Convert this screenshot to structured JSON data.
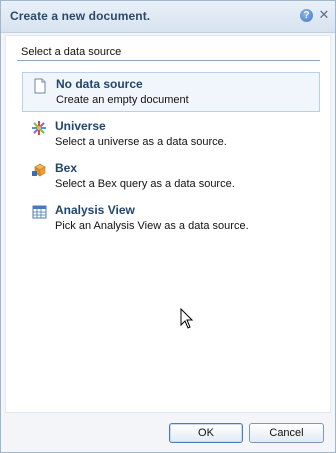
{
  "dialog": {
    "title": "Create a new document.",
    "help_icon": "help-icon",
    "close_icon": "close-icon",
    "section_label": "Select a data source",
    "options": [
      {
        "icon": "blank-document-icon",
        "title": "No data source",
        "description": "Create an empty document",
        "selected": true
      },
      {
        "icon": "universe-icon",
        "title": "Universe",
        "description": "Select a universe as a data source."
      },
      {
        "icon": "bex-query-icon",
        "title": "Bex",
        "description": "Select a Bex query as a data source."
      },
      {
        "icon": "analysis-view-icon",
        "title": "Analysis View",
        "description": "Pick an Analysis View as a data source."
      }
    ],
    "buttons": {
      "ok": "OK",
      "cancel": "Cancel"
    }
  }
}
